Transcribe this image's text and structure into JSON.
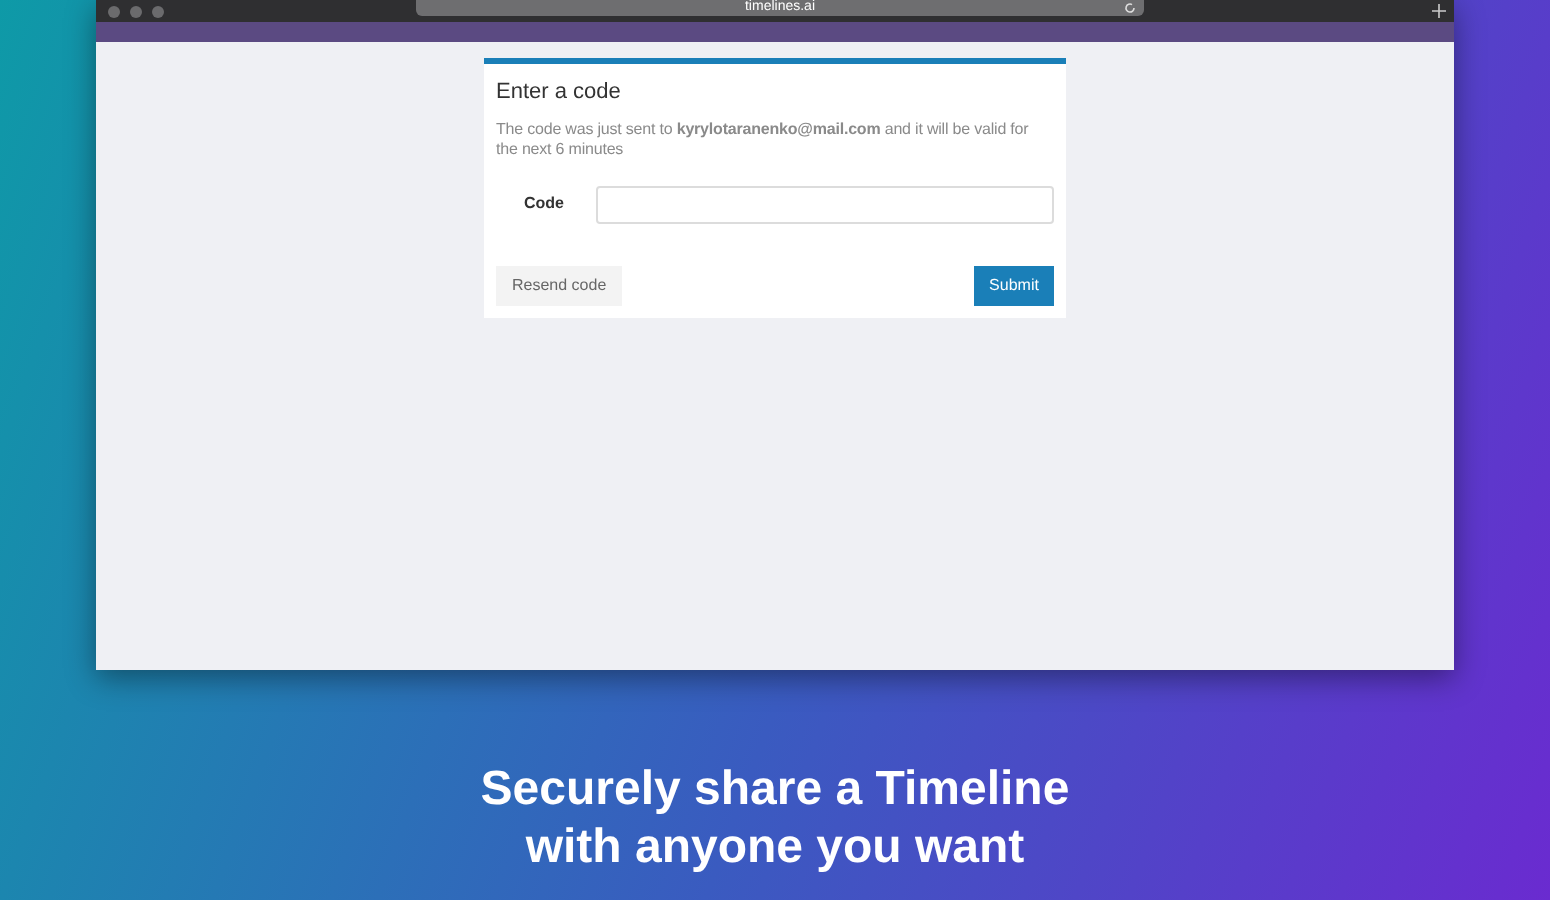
{
  "browser": {
    "url": "timelines.ai"
  },
  "form": {
    "title": "Enter a code",
    "message": "The code was just sent to **kyrylotaranenko@mail.com** and it will be valid for the next 6 minutes",
    "field_label": "Code",
    "resend_button": "Resend code",
    "submit_button": "Submit"
  },
  "headline": [
    "Securely share a Timeline",
    "with anyone you want"
  ]
}
